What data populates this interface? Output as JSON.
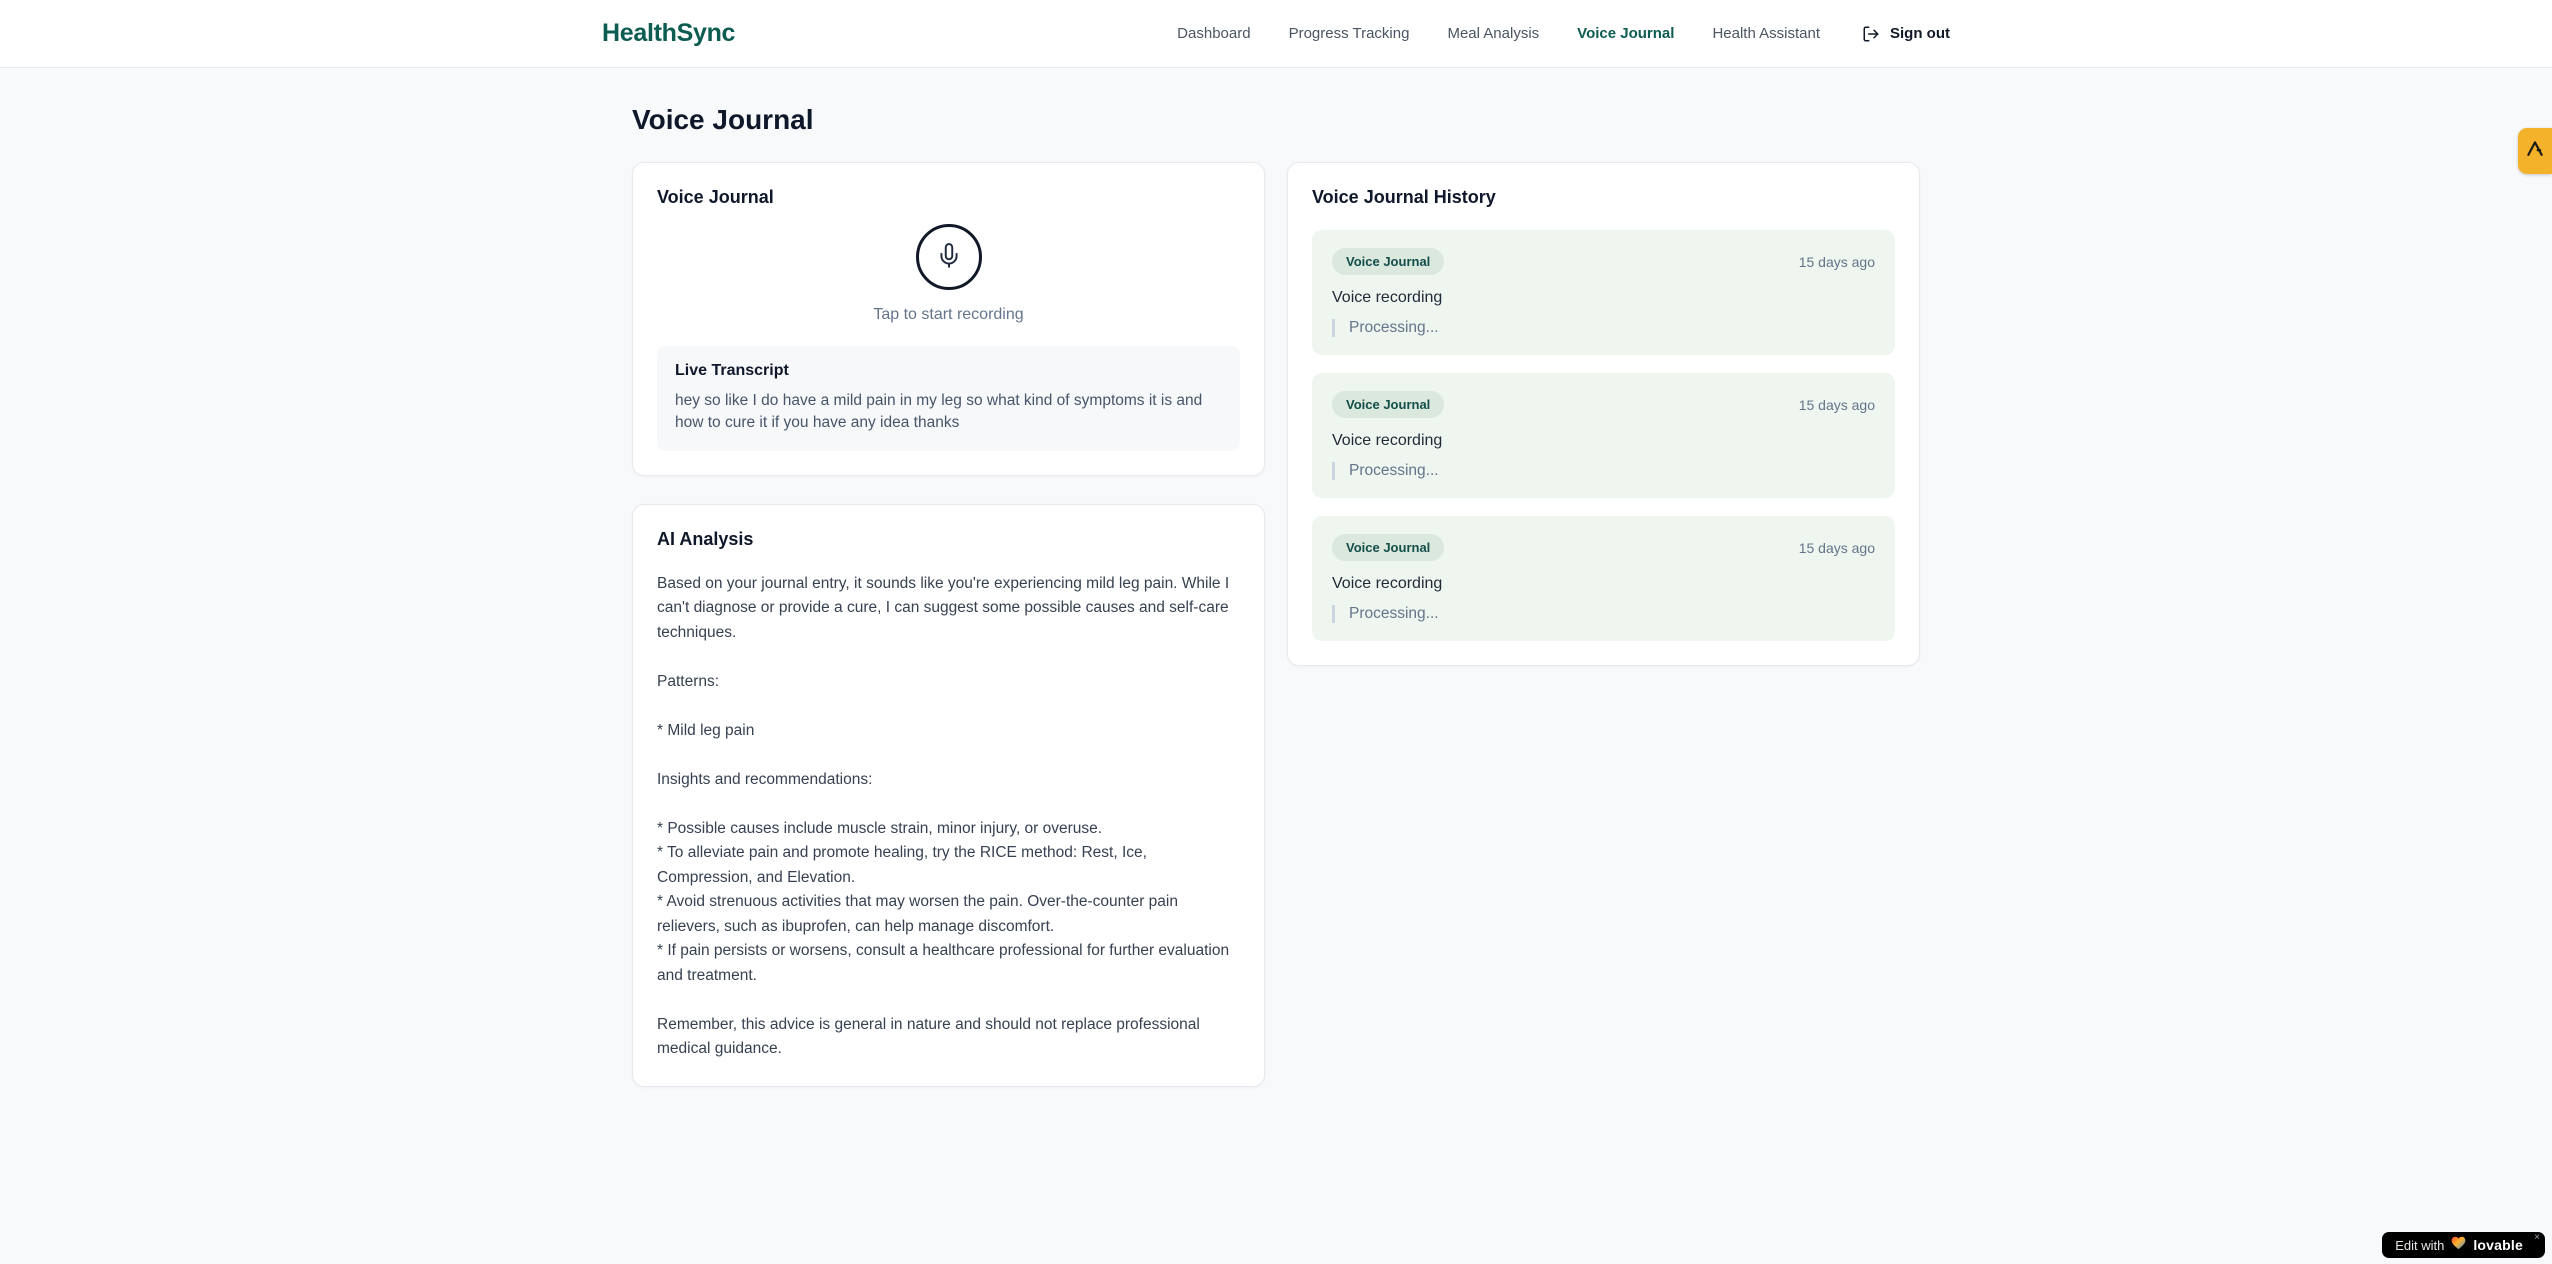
{
  "colors": {
    "brand": "#0c5c52",
    "page_bg": "#f8f9fb",
    "entry_bg": "#eef6ef",
    "badge_bg": "#dbe8de",
    "badge_text": "#134e4a",
    "tab_bg": "#f3b229",
    "mic_border": "#111827"
  },
  "brand": {
    "name": "HealthSync"
  },
  "nav": {
    "items": [
      {
        "label": "Dashboard",
        "active": false
      },
      {
        "label": "Progress Tracking",
        "active": false
      },
      {
        "label": "Meal Analysis",
        "active": false
      },
      {
        "label": "Voice Journal",
        "active": true
      },
      {
        "label": "Health Assistant",
        "active": false
      }
    ],
    "sign_out_label": "Sign out"
  },
  "page": {
    "title": "Voice Journal"
  },
  "recorder_card": {
    "title": "Voice Journal",
    "mic_icon": "microphone-icon",
    "mic_hint": "Tap to start recording",
    "transcript_title": "Live Transcript",
    "transcript_text": "hey so like I do have a mild pain in my leg so what kind of symptoms it is and how to cure it if you have any idea thanks"
  },
  "analysis_card": {
    "title": "AI Analysis",
    "body": "Based on your journal entry, it sounds like you're experiencing mild leg pain. While I can't diagnose or provide a cure, I can suggest some possible causes and self-care techniques.\n\nPatterns:\n\n* Mild leg pain\n\nInsights and recommendations:\n\n* Possible causes include muscle strain, minor injury, or overuse.\n* To alleviate pain and promote healing, try the RICE method: Rest, Ice, Compression, and Elevation.\n* Avoid strenuous activities that may worsen the pain. Over-the-counter pain relievers, such as ibuprofen, can help manage discomfort.\n* If pain persists or worsens, consult a healthcare professional for further evaluation and treatment.\n\nRemember, this advice is general in nature and should not replace professional medical guidance."
  },
  "history_card": {
    "title": "Voice Journal History",
    "entries": [
      {
        "badge": "Voice Journal",
        "time": "15 days ago",
        "label": "Voice recording",
        "status": "Processing..."
      },
      {
        "badge": "Voice Journal",
        "time": "15 days ago",
        "label": "Voice recording",
        "status": "Processing..."
      },
      {
        "badge": "Voice Journal",
        "time": "15 days ago",
        "label": "Voice recording",
        "status": "Processing..."
      }
    ]
  },
  "lovable_badge": {
    "prefix": "Edit with",
    "brand": "lovable",
    "close": "×"
  }
}
